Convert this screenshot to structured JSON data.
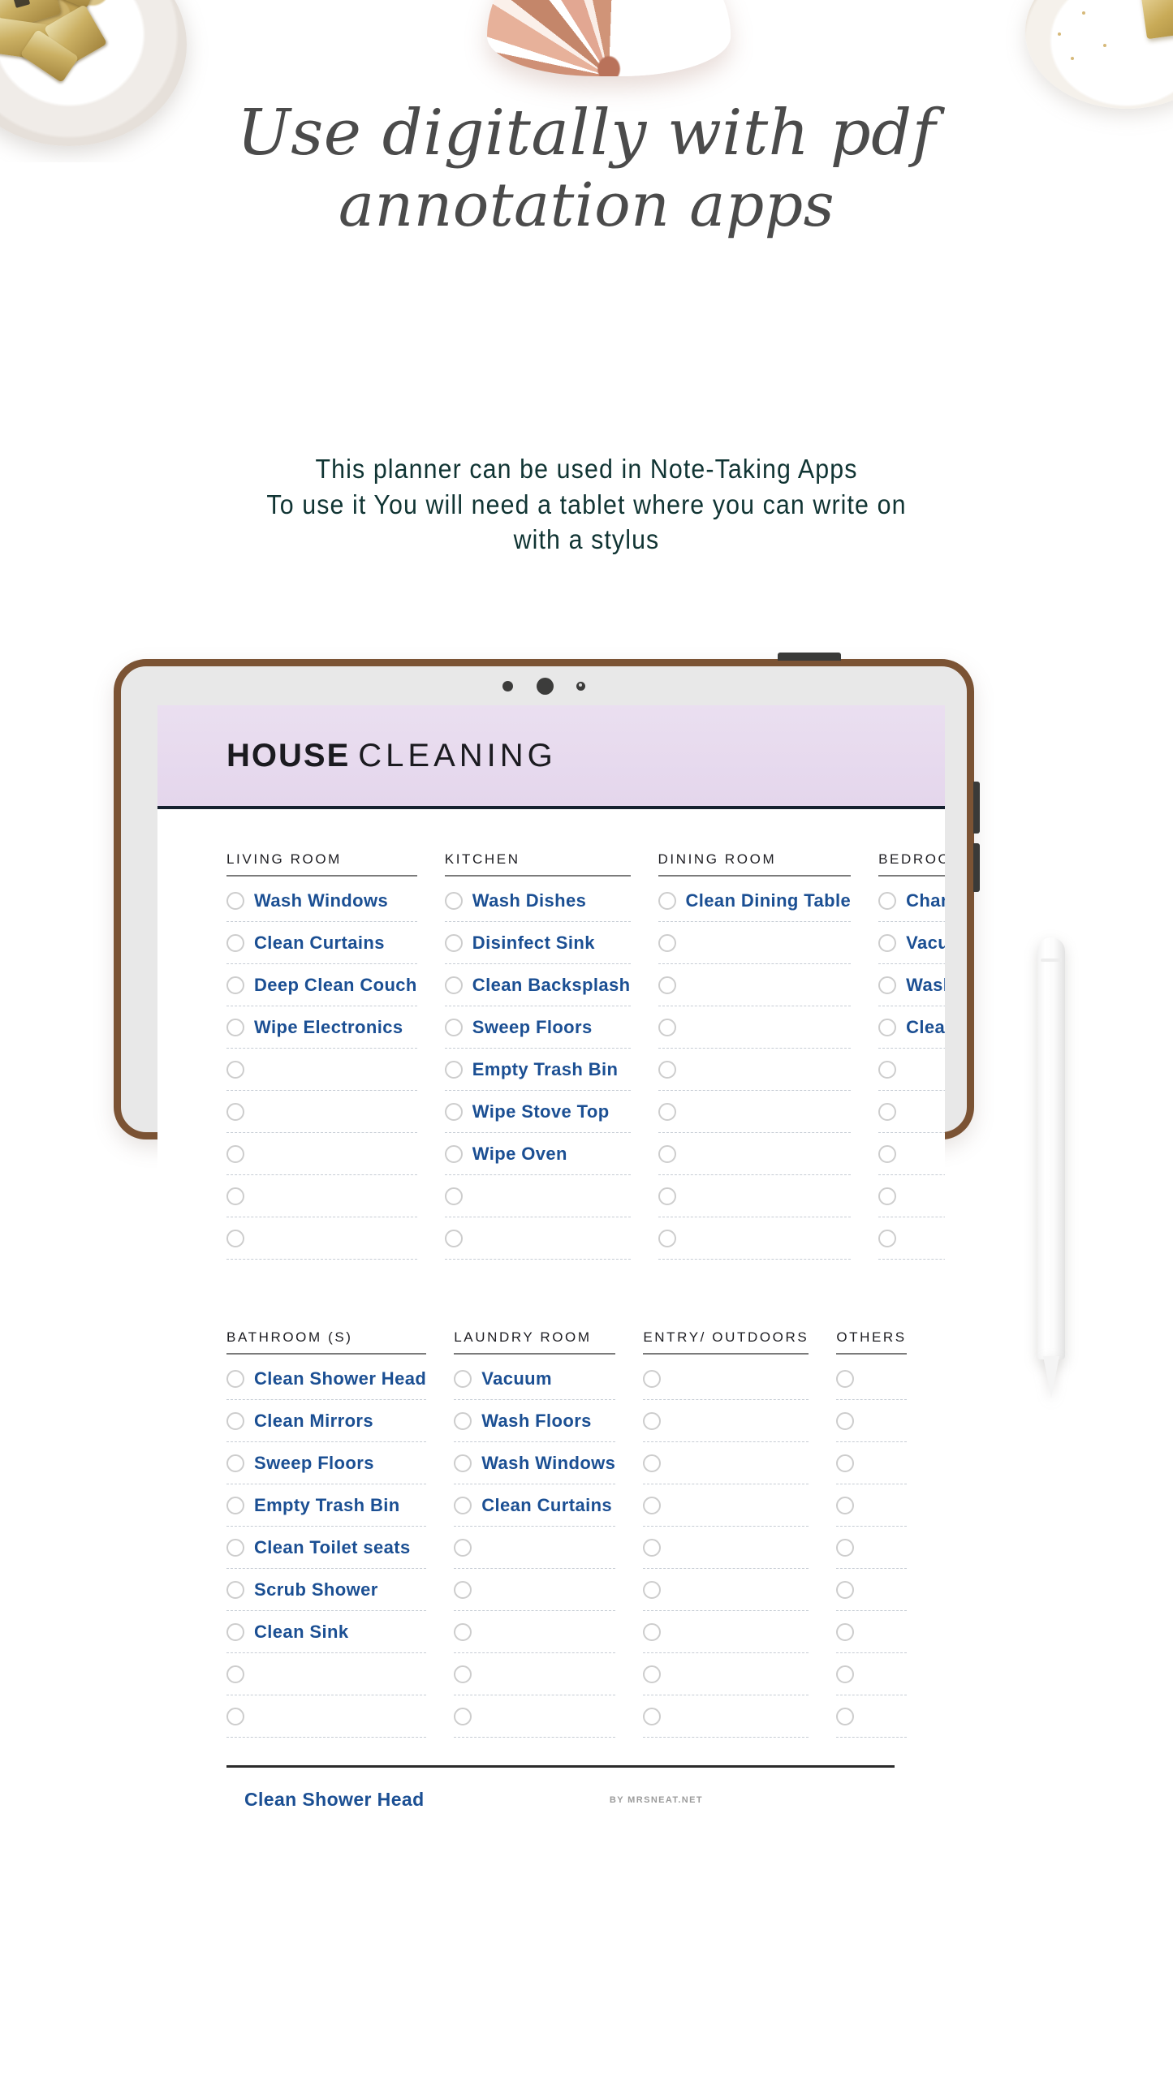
{
  "headline": {
    "line1": "Use digitally with pdf",
    "line2": "annotation apps"
  },
  "intro": {
    "line1": "This planner can be used in Note-Taking Apps",
    "line2": "To use it You will need a tablet where you can write on",
    "line3": "with a stylus"
  },
  "colors": {
    "task_blue": "#1b4f93",
    "header_lavender": "#e7daee",
    "intro_teal": "#103433",
    "tablet_frame": "#7b5334"
  },
  "planner": {
    "title_bold": "HOUSE",
    "title_light": "CLEANING",
    "footer_task": "Clean Shower Head",
    "watermark": "BY MRSNEAT.NET",
    "block1": [
      {
        "heading": "LIVING ROOM",
        "rows": 9,
        "items": [
          "Wash Windows",
          "Clean Curtains",
          "Deep Clean Couch",
          "Wipe Electronics",
          "",
          "",
          "",
          "",
          ""
        ]
      },
      {
        "heading": "KITCHEN",
        "rows": 9,
        "items": [
          "Wash Dishes",
          "Disinfect Sink",
          "Clean Backsplash",
          "Sweep Floors",
          "Empty Trash Bin",
          "Wipe Stove Top",
          "Wipe Oven",
          "",
          ""
        ]
      },
      {
        "heading": "DINING ROOM",
        "rows": 9,
        "items": [
          "Clean Dining Table",
          "",
          "",
          "",
          "",
          "",
          "",
          "",
          ""
        ]
      },
      {
        "heading": "BEDROOM (S)",
        "rows": 9,
        "items": [
          "Change Sheets",
          "Vacuum",
          "Wash Windows",
          "Clean Curtains",
          "",
          "",
          "",
          "",
          ""
        ]
      }
    ],
    "block2": [
      {
        "heading": "BATHROOM (S)",
        "rows": 9,
        "items": [
          "Clean Shower Head",
          "Clean Mirrors",
          "Sweep Floors",
          "Empty Trash Bin",
          "Clean Toilet seats",
          "Scrub Shower",
          "Clean Sink",
          "",
          ""
        ]
      },
      {
        "heading": "LAUNDRY ROOM",
        "rows": 9,
        "items": [
          "Vacuum",
          "Wash Floors",
          "Wash Windows",
          "Clean Curtains",
          "",
          "",
          "",
          "",
          ""
        ]
      },
      {
        "heading": "ENTRY/ OUTDOORS",
        "rows": 9,
        "items": [
          "",
          "",
          "",
          "",
          "",
          "",
          "",
          "",
          ""
        ]
      },
      {
        "heading": "OTHERS",
        "rows": 9,
        "items": [
          "",
          "",
          "",
          "",
          "",
          "",
          "",
          "",
          ""
        ]
      }
    ]
  }
}
